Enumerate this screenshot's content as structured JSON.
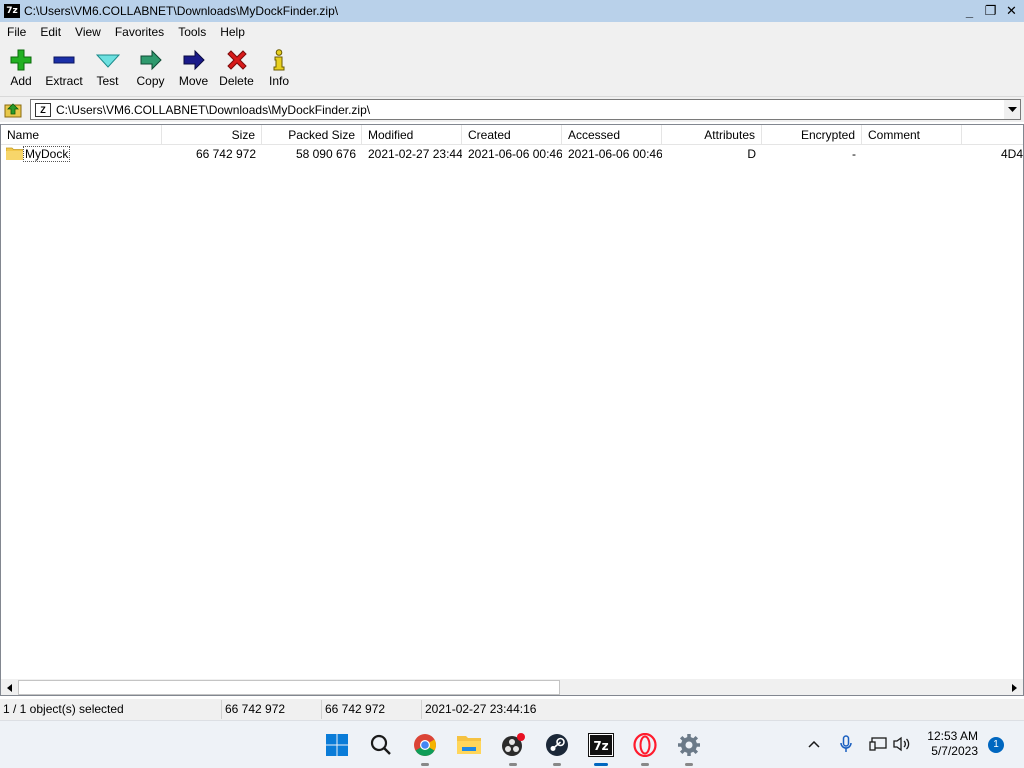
{
  "window": {
    "app_icon_text": "7z",
    "title": "C:\\Users\\VM6.COLLABNET\\Downloads\\MyDockFinder.zip\\",
    "controls": {
      "minimize": "_",
      "restore": "❐",
      "close": "✕"
    }
  },
  "menu": [
    "File",
    "Edit",
    "View",
    "Favorites",
    "Tools",
    "Help"
  ],
  "toolbar": {
    "add": "Add",
    "extract": "Extract",
    "test": "Test",
    "copy": "Copy",
    "move": "Move",
    "delete": "Delete",
    "info": "Info"
  },
  "address": {
    "path": "C:\\Users\\VM6.COLLABNET\\Downloads\\MyDockFinder.zip\\"
  },
  "columns": {
    "name": "Name",
    "size": "Size",
    "packed": "Packed Size",
    "modified": "Modified",
    "created": "Created",
    "accessed": "Accessed",
    "attributes": "Attributes",
    "encrypted": "Encrypted",
    "comment": "Comment"
  },
  "rows": [
    {
      "name": "MyDock",
      "size": "66 742 972",
      "packed": "58 090 676",
      "modified": "2021-02-27 23:44",
      "created": "2021-06-06 00:46",
      "accessed": "2021-06-06 00:46",
      "attributes": "D",
      "encrypted": "-",
      "comment": "",
      "overflow": "4D4"
    }
  ],
  "status": {
    "selection": "1 / 1 object(s) selected",
    "size": "66 742 972",
    "packed": "66 742 972",
    "date": "2021-02-27 23:44:16"
  },
  "taskbar": {
    "time": "12:53 AM",
    "date": "5/7/2023",
    "notification_count": "1",
    "app_7z_label": "7z"
  },
  "colors": {
    "title_bar": "#b9d1ea",
    "chrome": "#f0f0f0",
    "accent": "#0067c0"
  }
}
